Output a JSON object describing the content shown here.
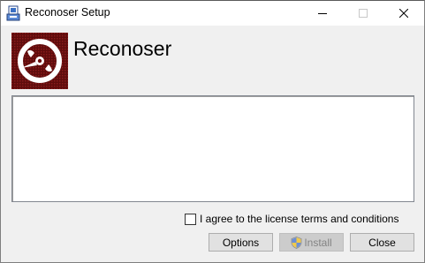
{
  "window": {
    "title": "Reconoser Setup",
    "icon": "installer-icon"
  },
  "caption_buttons": [
    "minimize-icon",
    "maximize-icon",
    "close-icon"
  ],
  "header": {
    "logo_icon": "disc-icon",
    "product_name": "Reconoser"
  },
  "license_text": "",
  "license_checkbox": {
    "label": "I agree to the license terms and conditions",
    "checked": false
  },
  "buttons": {
    "options": "Options",
    "install": "Install",
    "install_icon": "uac-shield-icon",
    "install_enabled": false,
    "close": "Close"
  },
  "colors": {
    "logo_bg": "#6e1010",
    "dialog_bg": "#f0f0f0",
    "button_bg": "#e1e1e1",
    "disabled_text": "#838383"
  }
}
